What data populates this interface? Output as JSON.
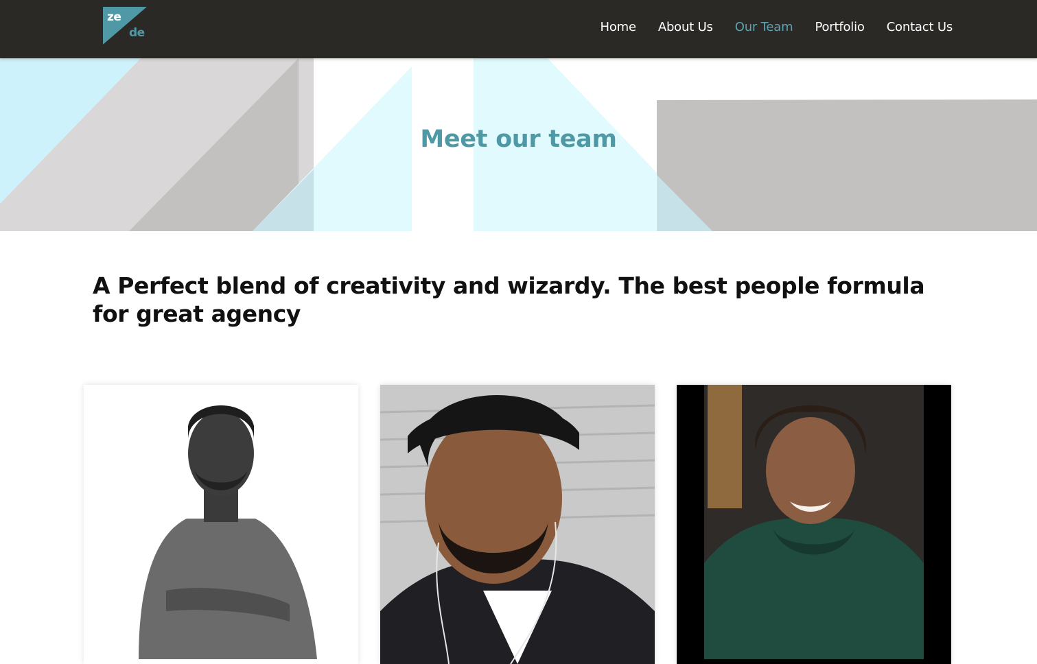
{
  "header": {
    "logo": {
      "text_top": "ze",
      "text_bottom": "de"
    },
    "nav": [
      {
        "label": "Home",
        "active": false
      },
      {
        "label": "About Us",
        "active": false
      },
      {
        "label": "Our Team",
        "active": true
      },
      {
        "label": "Portfolio",
        "active": false
      },
      {
        "label": "Contact Us",
        "active": false
      }
    ]
  },
  "hero": {
    "title": "Meet our team"
  },
  "intro": {
    "tagline": "A Perfect blend of creativity and wizardy. The best people formula for great agency"
  },
  "team": [
    {
      "photo": "team-member-1-photo",
      "style": "black-and-white"
    },
    {
      "photo": "team-member-2-photo",
      "style": "color"
    },
    {
      "photo": "team-member-3-photo",
      "style": "color"
    }
  ],
  "colors": {
    "header_bg": "#2b2926",
    "accent": "#5fa3b0",
    "hero_title": "#4f99a6",
    "light_cyan": "#cdf2fb",
    "light_grey": "#d9d7d7",
    "mid_grey": "#c3c1c0",
    "text": "#111111"
  }
}
